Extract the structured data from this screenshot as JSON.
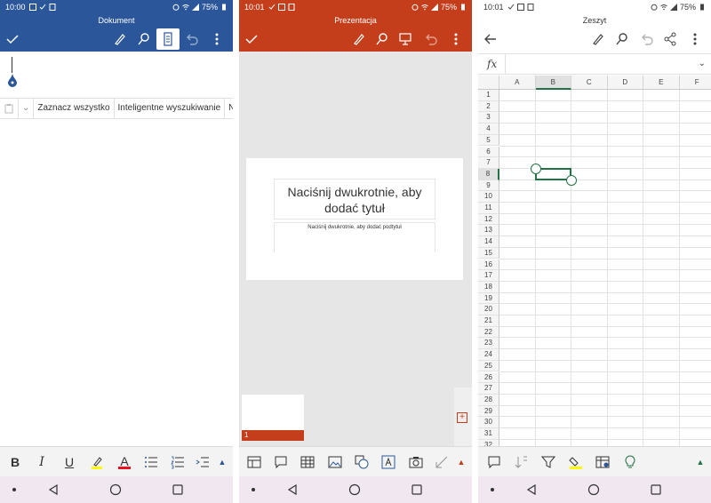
{
  "colors": {
    "word": "#2b579a",
    "powerpoint": "#c43e1c",
    "excel_accent": "#217346",
    "highlight_yellow": "#ffff00",
    "font_red": "#e81123"
  },
  "word": {
    "status": {
      "time": "10:00",
      "battery": "75%"
    },
    "title": "Dokument",
    "toolbar_icons": [
      "check-icon",
      "pen-icon",
      "search-icon",
      "mobile-view-icon",
      "undo-icon",
      "more-icon"
    ],
    "context_menu": [
      "Zaznacz wszystko",
      "Inteligentne wyszukiwanie",
      "N"
    ],
    "bottom_tools": {
      "bold": "B",
      "italic": "I",
      "underline": "U",
      "font_color": "A"
    }
  },
  "powerpoint": {
    "status": {
      "time": "10:01",
      "battery": "75%"
    },
    "title": "Prezentacja",
    "slide_title_placeholder": "Naciśnij dwukrotnie, aby dodać tytuł",
    "slide_subtitle_placeholder": "Naciśnij dwukrotnie, aby dodać podtytuł",
    "thumbnail_number": "1",
    "add_slide": "+"
  },
  "excel": {
    "status": {
      "time": "10:01",
      "battery": "75%"
    },
    "title": "Zeszyt",
    "formula_label": "fx",
    "columns": [
      "A",
      "B",
      "C",
      "D",
      "E",
      "F"
    ],
    "rows": [
      "1",
      "2",
      "3",
      "4",
      "5",
      "6",
      "7",
      "8",
      "9",
      "10",
      "11",
      "12",
      "13",
      "14",
      "15",
      "16",
      "17",
      "18",
      "19",
      "20",
      "21",
      "22",
      "23",
      "24",
      "25",
      "26",
      "27",
      "28",
      "29",
      "30",
      "31",
      "32"
    ],
    "selected_cell": "B8"
  }
}
